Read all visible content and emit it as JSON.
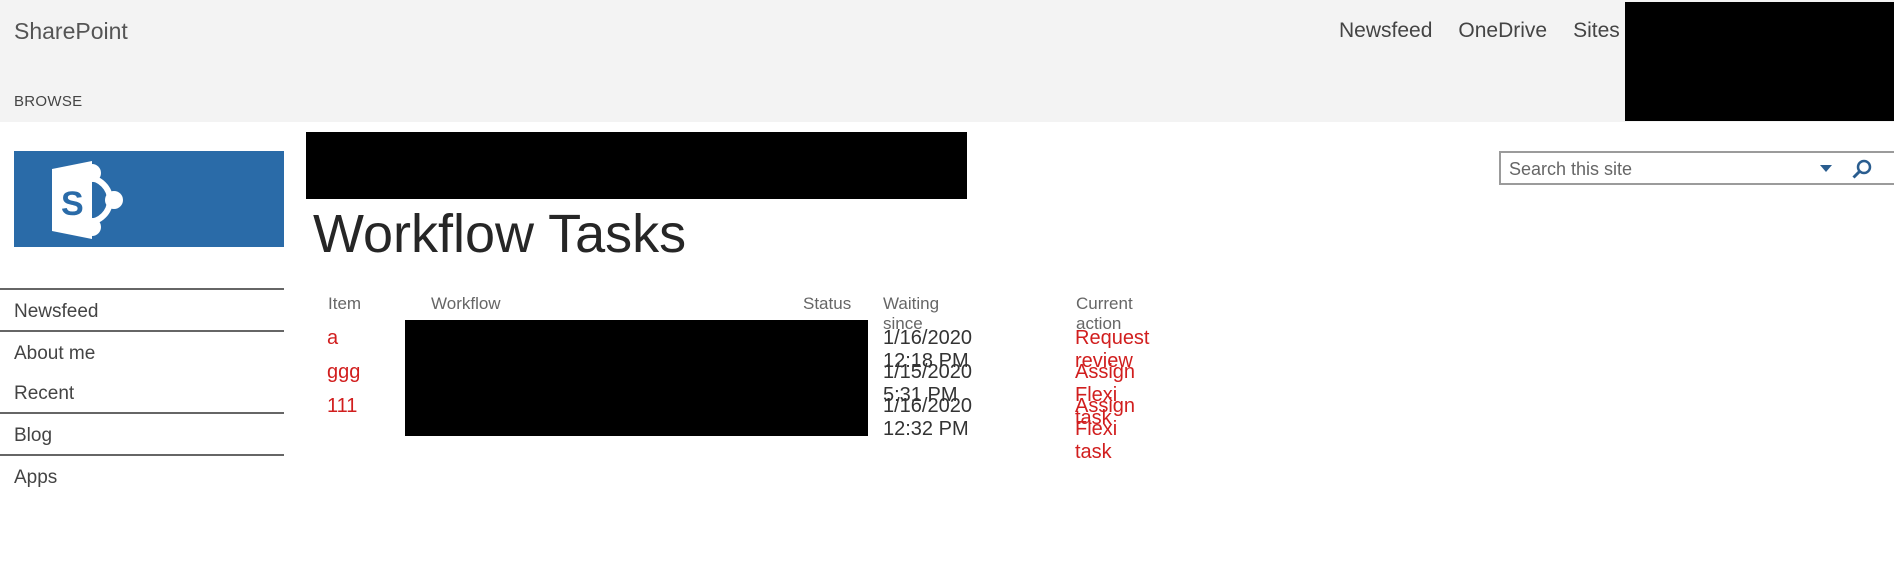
{
  "suitebar": {
    "brand": "SharePoint",
    "browse": "BROWSE",
    "nav": [
      "Newsfeed",
      "OneDrive",
      "Sites"
    ]
  },
  "leftnav": {
    "items": [
      "Newsfeed",
      "About me",
      "Recent",
      "Blog",
      "Apps"
    ]
  },
  "page": {
    "title": "Workflow Tasks"
  },
  "search": {
    "placeholder": "Search this site"
  },
  "table": {
    "headers": {
      "item": "Item",
      "workflow": "Workflow",
      "status": "Status",
      "waiting": "Waiting since",
      "action": "Current action"
    },
    "rows": [
      {
        "item": "a",
        "waiting": "1/16/2020 12:18 PM",
        "action": "Request review"
      },
      {
        "item": "ggg",
        "waiting": "1/15/2020 5:31 PM",
        "action": "Assign Flexi task"
      },
      {
        "item": "111",
        "waiting": "1/16/2020 12:32 PM",
        "action": "Assign Flexi task"
      }
    ]
  },
  "colors": {
    "accent": "#2a6ba8",
    "link": "#d11e1e",
    "suitebar": "#f3f3f3"
  }
}
